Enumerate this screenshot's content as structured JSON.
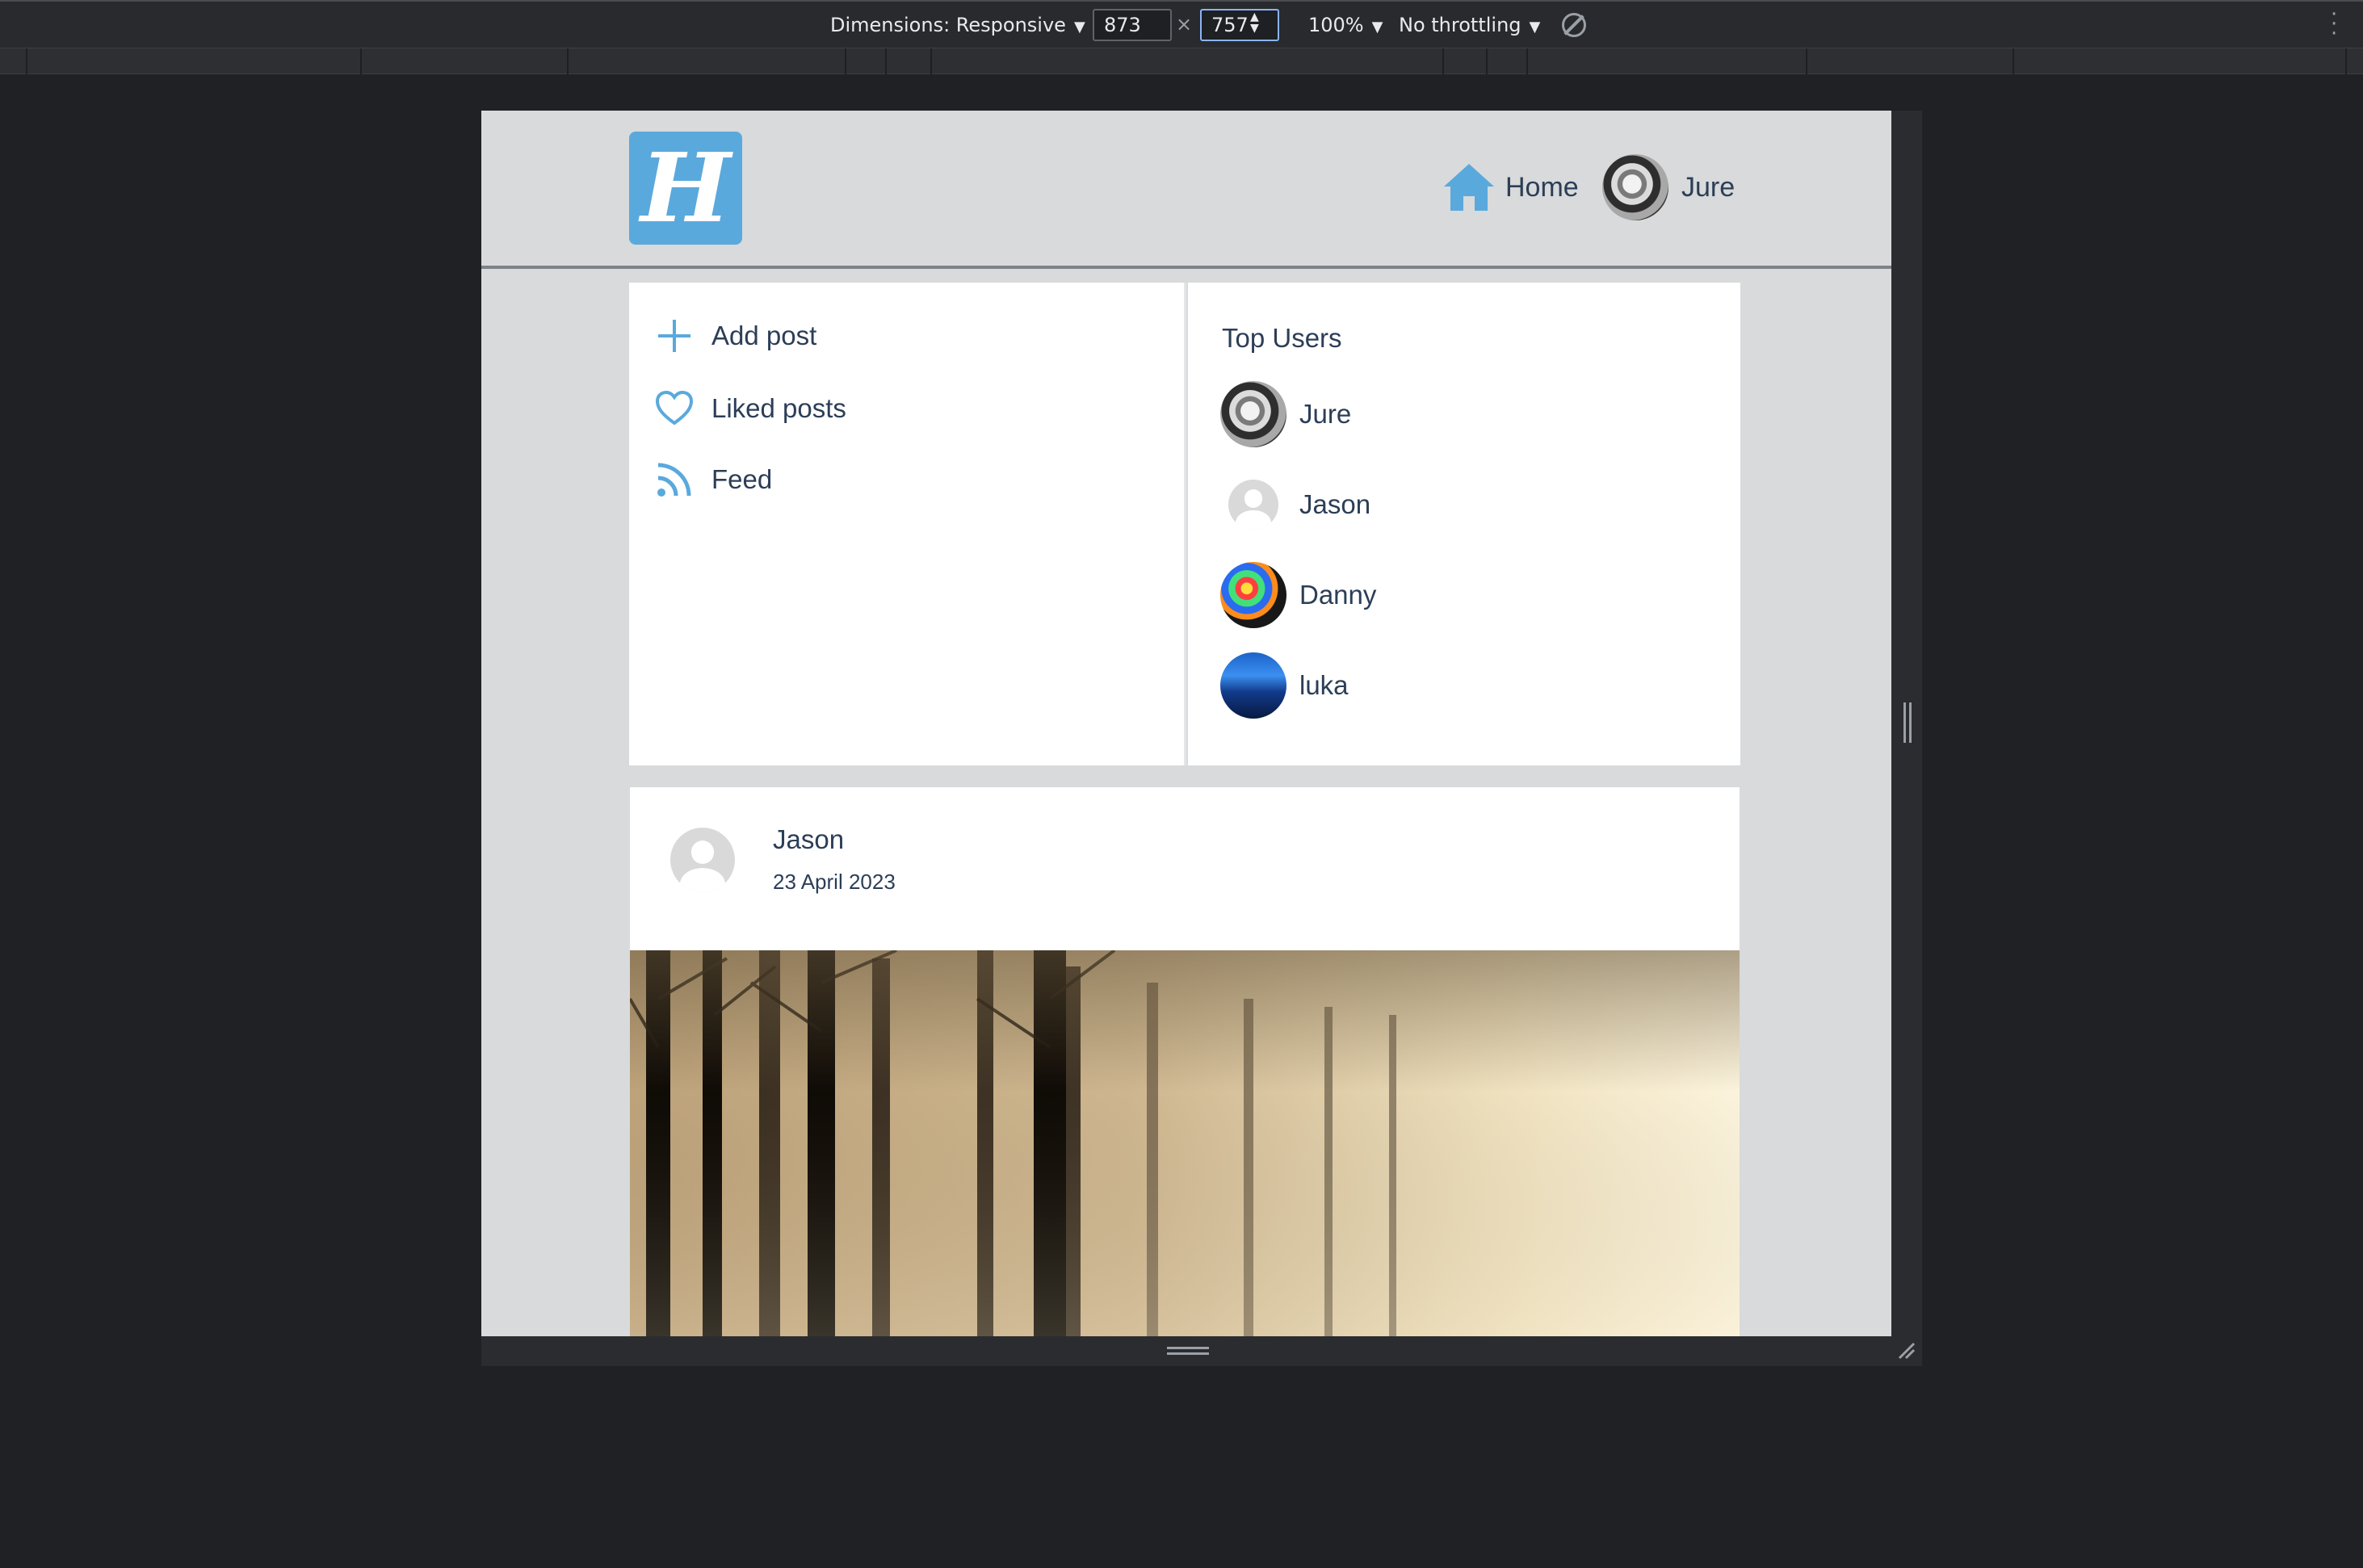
{
  "devtools": {
    "dimensions_label": "Dimensions: Responsive",
    "width": "873",
    "height": "757",
    "times": "×",
    "zoom": "100%",
    "throttling": "No throttling"
  },
  "site": {
    "logo_letter": "H",
    "nav": {
      "home_label": "Home",
      "user_label": "Jure"
    },
    "menu": [
      {
        "label": "Add post",
        "icon": "plus-icon"
      },
      {
        "label": "Liked posts",
        "icon": "heart-icon"
      },
      {
        "label": "Feed",
        "icon": "rss-icon"
      }
    ],
    "top_users": {
      "title": "Top Users",
      "users": [
        {
          "name": "Jure",
          "avatar": "photo-avatar"
        },
        {
          "name": "Jason",
          "avatar": "default-avatar"
        },
        {
          "name": "Danny",
          "avatar": "colorful-avatar"
        },
        {
          "name": "luka",
          "avatar": "blue-landscape-avatar"
        }
      ]
    },
    "post": {
      "author": "Jason",
      "date": "23 April 2023",
      "image": "foggy-forest-photo"
    },
    "colors": {
      "accent": "#5aa9dd",
      "text": "#2c3e57",
      "background": "#d8dadb"
    }
  }
}
